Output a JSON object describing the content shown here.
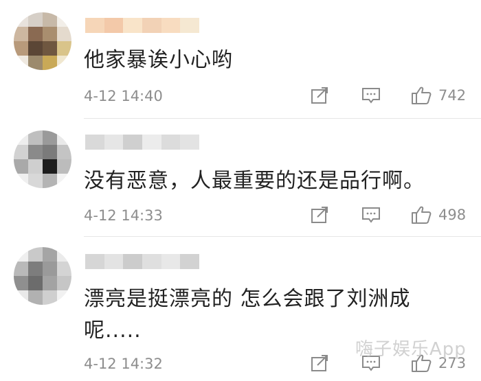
{
  "comments": [
    {
      "text": "他家暴诶小心哟",
      "time": "4-12 14:40",
      "likes": "742",
      "avatar_colors": [
        "#e8e2dc",
        "#d6cfc7",
        "#c7b9a8",
        "#f2eee8",
        "#cdb7a0",
        "#8a6a52",
        "#a98e6f",
        "#e4dacd",
        "#b89a7b",
        "#5b4636",
        "#6f5740",
        "#d9c48a",
        "#efe9e0",
        "#9c8a6d",
        "#c9a957",
        "#f0e7cf"
      ],
      "name_colors": [
        "#f6d6b8",
        "#f3c9a9",
        "#f9e4c9",
        "#f2d2b6",
        "#f8dcc0",
        "#f5e8d2"
      ]
    },
    {
      "text": "没有恶意，人最重要的还是品行啊。",
      "time": "4-12 14:33",
      "likes": "498",
      "avatar_colors": [
        "#ededed",
        "#bfbfbf",
        "#9a9a9a",
        "#e9e9e9",
        "#d2d2d2",
        "#8a8a8a",
        "#7b7b7b",
        "#c4c4c4",
        "#a9a9a9",
        "#cfcfcf",
        "#1d1d1d",
        "#bcbcbc",
        "#efefef",
        "#d8d8d8",
        "#b4b4b4",
        "#f3f3f3"
      ],
      "name_colors": [
        "#d9d9d9",
        "#e6e6e6",
        "#cfcfcf",
        "#ececec",
        "#dcdcdc",
        "#e3e3e3"
      ]
    },
    {
      "text_line1": "漂亮是挺漂亮的 怎么会跟了刘洲成",
      "text_line2": "呢.....",
      "time": "4-12 14:32",
      "likes": "273",
      "avatar_colors": [
        "#efefef",
        "#c9c9c9",
        "#a5a5a5",
        "#ebebeb",
        "#b9b9b9",
        "#7d7d7d",
        "#9a9a9a",
        "#d4d4d4",
        "#8f8f8f",
        "#6c6c6c",
        "#a3a3a3",
        "#c6c6c6",
        "#e9e9e9",
        "#b1b1b1",
        "#cfcfcf",
        "#f1f1f1"
      ],
      "name_colors": [
        "#d6d6d6",
        "#e3e3e3",
        "#cccccc",
        "#dfdfdf",
        "#e8e8e8",
        "#d2d2d2"
      ]
    }
  ],
  "watermark": "嗨子娱乐App",
  "colors": {
    "meta_gray": "#8d8d8d",
    "icon_gray": "#8a8a8a",
    "text": "#222222"
  }
}
